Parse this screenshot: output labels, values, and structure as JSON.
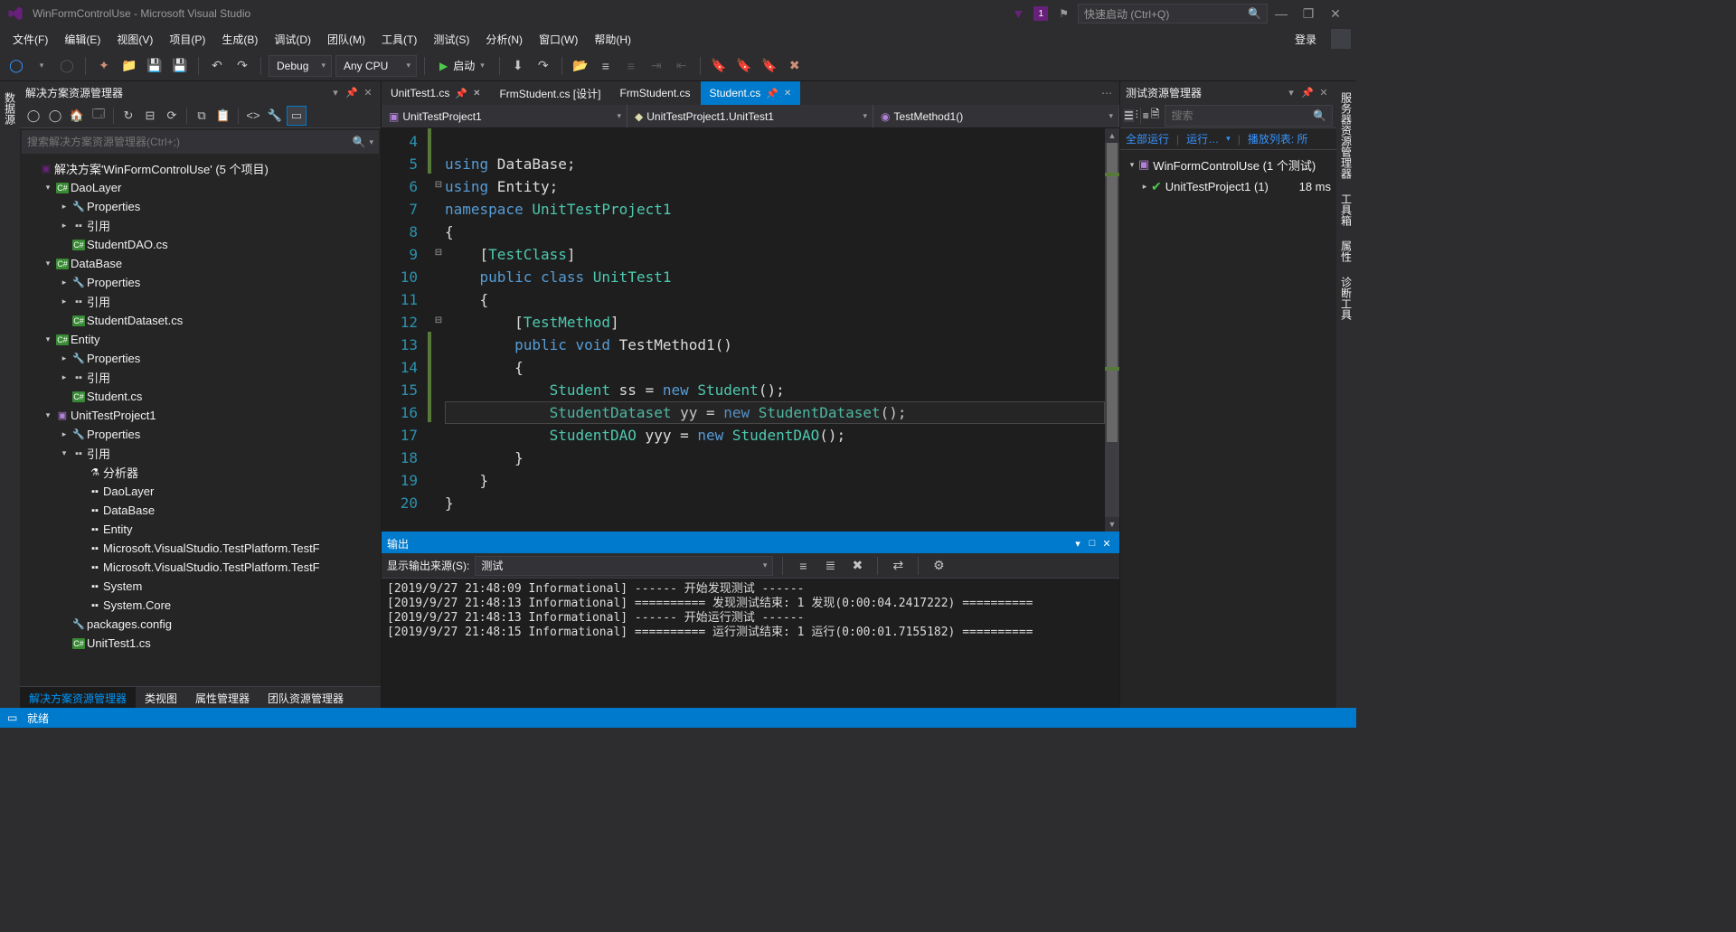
{
  "title": "WinFormControlUse - Microsoft Visual Studio",
  "notif_count": "1",
  "quick_launch": "快速启动 (Ctrl+Q)",
  "menu": [
    "文件(F)",
    "编辑(E)",
    "视图(V)",
    "项目(P)",
    "生成(B)",
    "调试(D)",
    "团队(M)",
    "工具(T)",
    "测试(S)",
    "分析(N)",
    "窗口(W)",
    "帮助(H)"
  ],
  "login": "登录",
  "toolbar": {
    "config": "Debug",
    "platform": "Any CPU",
    "start": "启动"
  },
  "leftrail": "数据源",
  "rightrail": [
    "服务器资源管理器",
    "工具箱",
    "属性",
    "诊断工具"
  ],
  "sln_explorer": {
    "title": "解决方案资源管理器",
    "search_placeholder": "搜索解决方案资源管理器(Ctrl+;)",
    "root": "解决方案'WinFormControlUse' (5 个项目)",
    "projects": [
      {
        "name": "DaoLayer",
        "kind": "csproj",
        "children": [
          {
            "name": "Properties",
            "kind": "prop"
          },
          {
            "name": "引用",
            "kind": "ref"
          },
          {
            "name": "StudentDAO.cs",
            "kind": "cs"
          }
        ]
      },
      {
        "name": "DataBase",
        "kind": "csproj",
        "children": [
          {
            "name": "Properties",
            "kind": "prop"
          },
          {
            "name": "引用",
            "kind": "ref"
          },
          {
            "name": "StudentDataset.cs",
            "kind": "cs"
          }
        ]
      },
      {
        "name": "Entity",
        "kind": "csproj",
        "children": [
          {
            "name": "Properties",
            "kind": "prop"
          },
          {
            "name": "引用",
            "kind": "ref"
          },
          {
            "name": "Student.cs",
            "kind": "cs"
          }
        ]
      },
      {
        "name": "UnitTestProject1",
        "kind": "test",
        "children": [
          {
            "name": "Properties",
            "kind": "prop"
          },
          {
            "name": "引用",
            "kind": "ref",
            "expanded": true,
            "children": [
              {
                "name": "分析器",
                "kind": "analyzer"
              },
              {
                "name": "DaoLayer",
                "kind": "refitem"
              },
              {
                "name": "DataBase",
                "kind": "refitem"
              },
              {
                "name": "Entity",
                "kind": "refitem"
              },
              {
                "name": "Microsoft.VisualStudio.TestPlatform.TestF",
                "kind": "refitem"
              },
              {
                "name": "Microsoft.VisualStudio.TestPlatform.TestF",
                "kind": "refitem"
              },
              {
                "name": "System",
                "kind": "refitem"
              },
              {
                "name": "System.Core",
                "kind": "refitem"
              }
            ]
          },
          {
            "name": "packages.config",
            "kind": "config"
          },
          {
            "name": "UnitTest1.cs",
            "kind": "cs"
          }
        ]
      }
    ],
    "tabs": [
      "解决方案资源管理器",
      "类视图",
      "属性管理器",
      "团队资源管理器"
    ]
  },
  "doctabs": [
    {
      "label": "UnitTest1.cs",
      "active": false,
      "pinned": true
    },
    {
      "label": "FrmStudent.cs [设计]",
      "active": false
    },
    {
      "label": "FrmStudent.cs",
      "active": false
    },
    {
      "label": "Student.cs",
      "active": true,
      "pinned": true
    }
  ],
  "navbar": [
    "UnitTestProject1",
    "UnitTestProject1.UnitTest1",
    "TestMethod1()"
  ],
  "code_lines": [
    4,
    5,
    6,
    7,
    8,
    9,
    10,
    11,
    12,
    13,
    14,
    15,
    16,
    17,
    18,
    19,
    20
  ],
  "output": {
    "title": "输出",
    "source_label": "显示输出来源(S):",
    "source": "测试",
    "lines": [
      "[2019/9/27 21:48:09 Informational] ------ 开始发现测试 ------",
      "[2019/9/27 21:48:13 Informational] ========== 发现测试结束: 1 发现(0:00:04.2417222) ==========",
      "[2019/9/27 21:48:13 Informational] ------ 开始运行测试 ------",
      "[2019/9/27 21:48:15 Informational] ========== 运行测试结束: 1 运行(0:00:01.7155182) =========="
    ]
  },
  "test_explorer": {
    "title": "测试资源管理器",
    "search_placeholder": "搜索",
    "links": [
      "全部运行",
      "运行…",
      "播放列表: 所"
    ],
    "root": "WinFormControlUse (1 个测试)",
    "child": "UnitTestProject1 (1)",
    "time": "18 ms"
  },
  "status": "就绪"
}
